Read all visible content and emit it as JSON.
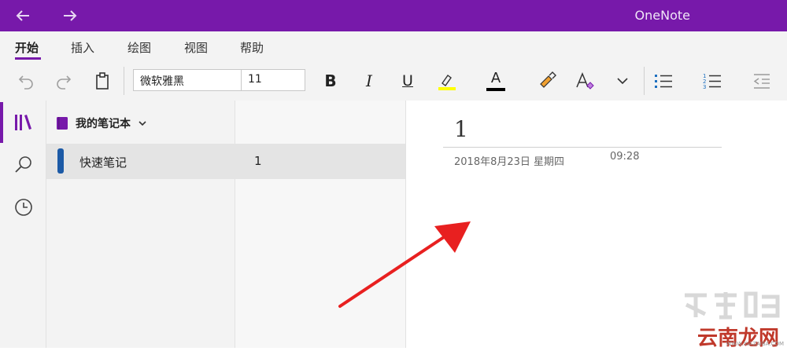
{
  "titlebar": {
    "app_title": "OneNote",
    "accent": "#7719aa"
  },
  "ribbon": {
    "tabs": [
      {
        "label": "开始",
        "active": true
      },
      {
        "label": "插入"
      },
      {
        "label": "绘图"
      },
      {
        "label": "视图"
      },
      {
        "label": "帮助"
      }
    ],
    "font_name": "微软雅黑",
    "font_size": "11",
    "bold_label": "B",
    "italic_label": "I",
    "underline_label": "U",
    "font_color_label": "A",
    "highlight_color": "#ffff00",
    "font_color": "#000000"
  },
  "notebook": {
    "name": "我的笔记本",
    "sections": [
      {
        "label": "快速笔记",
        "color": "#1c5aa6"
      }
    ],
    "pages": [
      {
        "label": "1"
      }
    ]
  },
  "page": {
    "title": "1",
    "date": "2018年8月23日 星期四",
    "time": "09:28"
  },
  "watermark": {
    "main": "云南龙网",
    "sub": "WWW.XIAZAIBA.COM"
  }
}
